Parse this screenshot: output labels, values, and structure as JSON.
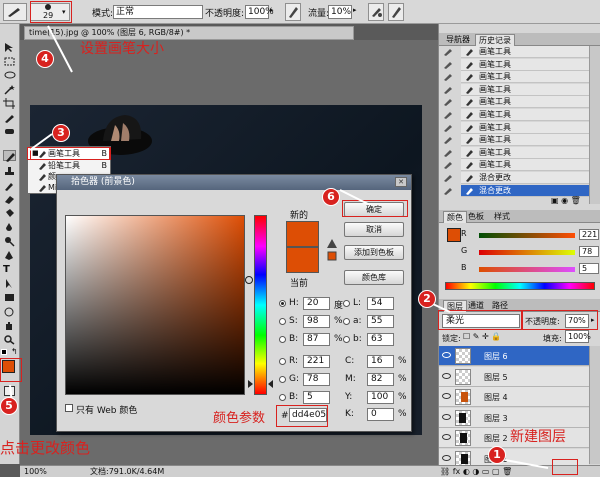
{
  "options_bar": {
    "brush_size": "29",
    "mode_label": "模式:",
    "mode_value": "正常",
    "opacity_label": "不透明度:",
    "opacity_value": "100%",
    "flow_label": "流量:",
    "flow_value": "10%"
  },
  "document": {
    "tab_title": "time(15).jpg @ 100% (图层 6, RGB/8#) *"
  },
  "status_bar": {
    "zoom": "100%",
    "doc_info": "文档:791.0K/4.64M"
  },
  "tool_flyout": {
    "items": [
      {
        "label": "画笔工具",
        "key": "B"
      },
      {
        "label": "铅笔工具",
        "key": "B"
      },
      {
        "label": "颜",
        "key": ""
      },
      {
        "label": "Mi",
        "key": ""
      }
    ]
  },
  "history_panel": {
    "tabs": [
      "导航器",
      "历史记录"
    ],
    "rows": [
      "画笔工具",
      "画笔工具",
      "画笔工具",
      "画笔工具",
      "画笔工具",
      "画笔工具",
      "画笔工具",
      "画笔工具",
      "画笔工具",
      "画笔工具",
      "混合更改",
      "混合更改"
    ]
  },
  "color_panel": {
    "tabs": [
      "颜色",
      "色板",
      "样式"
    ],
    "r_label": "R",
    "r_value": "221",
    "g_label": "G",
    "g_value": "78",
    "b_label": "B",
    "b_value": "5"
  },
  "layers_panel": {
    "tabs": [
      "图层",
      "通道",
      "路径"
    ],
    "blend_mode": "柔光",
    "opacity_label": "不透明度:",
    "opacity_value": "70%",
    "lock_label": "锁定:",
    "fill_label": "填充:",
    "fill_value": "100%",
    "layers": [
      "图层 6",
      "图层 5",
      "图层 4",
      "图层 3",
      "图层 2",
      "图层 1"
    ]
  },
  "color_picker": {
    "title": "拾色器 (前景色)",
    "new_label": "新的",
    "current_label": "当前",
    "ok": "确定",
    "cancel": "取消",
    "add_swatch": "添加到色板",
    "color_library": "颜色库",
    "h_label": "H:",
    "h_value": "20",
    "h_unit": "度",
    "s_label": "S:",
    "s_value": "98",
    "s_unit": "%",
    "b_label": "B:",
    "b_value": "87",
    "b_unit": "%",
    "r_label": "R:",
    "r_value": "221",
    "g_label": "G:",
    "g_value": "78",
    "bb_label": "B:",
    "bb_value": "5",
    "l_label": "L:",
    "l_value": "54",
    "a_label": "a:",
    "a_value": "55",
    "b2_label": "b:",
    "b2_value": "63",
    "c_label": "C:",
    "c_value": "16",
    "c_unit": "%",
    "m_label": "M:",
    "m_value": "82",
    "m_unit": "%",
    "y_label": "Y:",
    "y_value": "100",
    "y_unit": "%",
    "k_label": "K:",
    "k_value": "0",
    "k_unit": "%",
    "hex_label": "#",
    "hex_value": "dd4e05",
    "web_only": "只有 Web 颜色",
    "selected_color": "#dd4e05"
  },
  "annotations": {
    "set_brush_size": "设置画笔大小",
    "click_change_color": "点击更改颜色",
    "new_layer": "新建图层",
    "color_params": "颜色参数",
    "n1": "1",
    "n2": "2",
    "n3": "3",
    "n4": "4",
    "n5": "5",
    "n6": "6"
  }
}
